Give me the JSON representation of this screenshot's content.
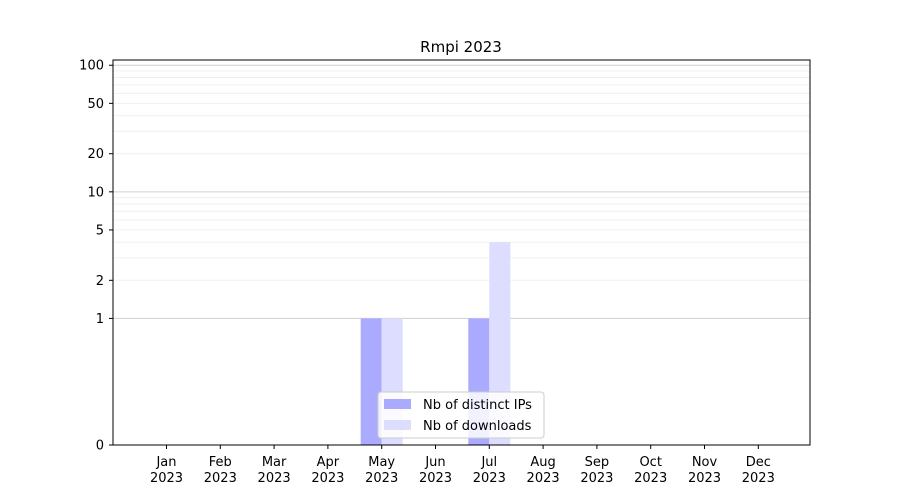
{
  "chart_data": {
    "type": "bar",
    "title": "Rmpi 2023",
    "xlabel": "",
    "ylabel": "",
    "y_scale": "symlog",
    "ylim": [
      0,
      110
    ],
    "y_ticks": [
      0,
      1,
      2,
      5,
      10,
      20,
      50,
      100
    ],
    "y_tick_labels": [
      "0",
      "1",
      "2",
      "5",
      "10",
      "20",
      "50",
      "100"
    ],
    "grid": true,
    "legend_position": "lower-center",
    "categories": [
      {
        "month": "Jan",
        "year": "2023"
      },
      {
        "month": "Feb",
        "year": "2023"
      },
      {
        "month": "Mar",
        "year": "2023"
      },
      {
        "month": "Apr",
        "year": "2023"
      },
      {
        "month": "May",
        "year": "2023"
      },
      {
        "month": "Jun",
        "year": "2023"
      },
      {
        "month": "Jul",
        "year": "2023"
      },
      {
        "month": "Aug",
        "year": "2023"
      },
      {
        "month": "Sep",
        "year": "2023"
      },
      {
        "month": "Oct",
        "year": "2023"
      },
      {
        "month": "Nov",
        "year": "2023"
      },
      {
        "month": "Dec",
        "year": "2023"
      }
    ],
    "series": [
      {
        "name": "Nb of distinct IPs",
        "color": "#aaaaff",
        "values": [
          0,
          0,
          0,
          0,
          1,
          0,
          1,
          0,
          0,
          0,
          0,
          0
        ]
      },
      {
        "name": "Nb of downloads",
        "color": "#ddddff",
        "values": [
          0,
          0,
          0,
          0,
          1,
          0,
          4,
          0,
          0,
          0,
          0,
          0
        ]
      }
    ]
  }
}
